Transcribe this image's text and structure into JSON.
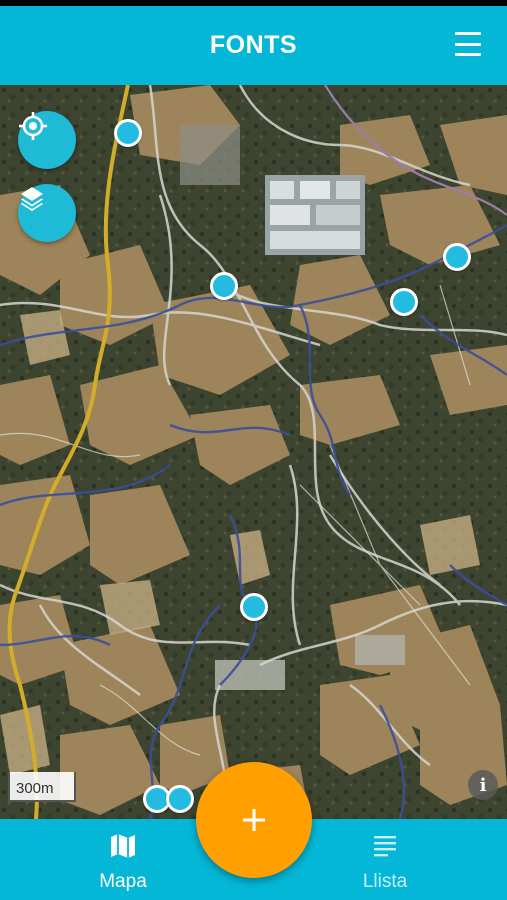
{
  "app": {
    "title": "FONTS",
    "accent_color": "#04b7d6",
    "add_button_color": "#ffa000"
  },
  "header": {
    "menu_icon": "hamburger-menu-icon"
  },
  "map": {
    "controls": [
      {
        "name": "my-location",
        "icon": "crosshair-icon"
      },
      {
        "name": "layers",
        "icon": "layers-icon"
      }
    ],
    "scale_label": "300m",
    "info_icon": "i",
    "marker_count": 8
  },
  "fab": {
    "icon": "plus-icon",
    "label": "+"
  },
  "bottom_nav": {
    "tabs": [
      {
        "label": "Mapa",
        "icon": "map-icon",
        "active": true
      },
      {
        "label": "Llista",
        "icon": "list-icon",
        "active": false
      }
    ]
  }
}
